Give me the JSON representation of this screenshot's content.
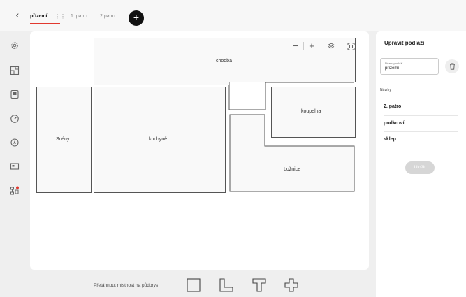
{
  "header": {
    "tabs": [
      {
        "label": "přízemí",
        "active": true
      },
      {
        "label": "1. patro",
        "active": false
      },
      {
        "label": "2.patro",
        "active": false
      }
    ],
    "grip_icon": "drag-handle-icon",
    "add_label": "+",
    "accent_color": "#e1382e"
  },
  "nav": {
    "icons": [
      "settings-icon",
      "floorplan-icon",
      "device-icon",
      "gauge-icon",
      "location-icon",
      "screen-icon",
      "network-alert-icon"
    ]
  },
  "canvas": {
    "rooms": [
      {
        "name": "chodba"
      },
      {
        "name": "Scény"
      },
      {
        "name": "kuchyně"
      },
      {
        "name": "koupelna"
      },
      {
        "name": "Ložnice"
      }
    ],
    "zoom": {
      "minus": "−",
      "plus": "+"
    }
  },
  "shapes_bar": {
    "label": "Přetáhnout místnost na půdorys",
    "shapes": [
      "square-shape",
      "l-shape",
      "t-shape",
      "cross-shape"
    ]
  },
  "panel": {
    "title": "Upravit podlaží",
    "name_field": {
      "label": "Název podlaží",
      "value": "přízemí"
    },
    "suggestions_title": "Návrhy",
    "suggestions": [
      "2. patro",
      "podkroví",
      "sklep"
    ],
    "save_label": "Uložit"
  }
}
